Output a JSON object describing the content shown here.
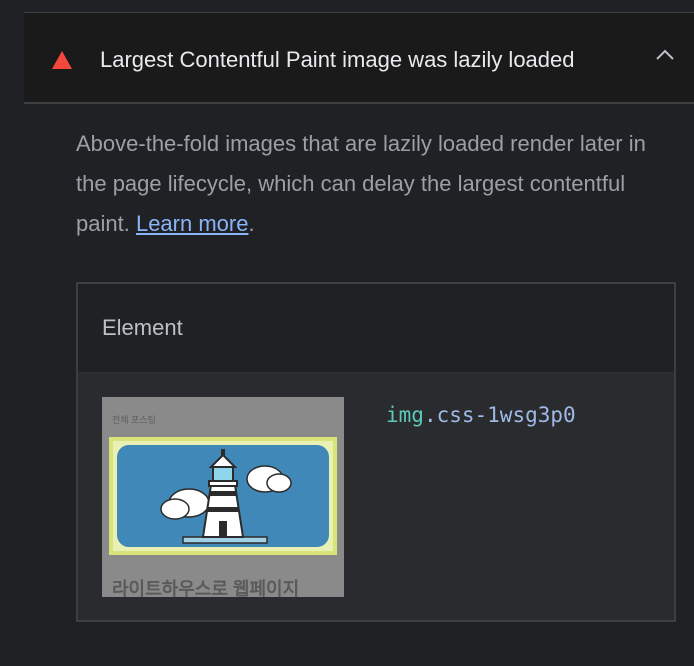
{
  "audit": {
    "title": "Largest Contentful Paint image was lazily loaded",
    "status_icon": "fail-triangle-icon",
    "status_color": "#f4483c",
    "expanded": true
  },
  "description": {
    "text": "Above-the-fold images that are lazily loaded render later in the page lifecycle, which can delay the largest contentful paint.",
    "link_label": "Learn more",
    "trailing": "."
  },
  "table": {
    "headers": [
      "Element"
    ],
    "rows": [
      {
        "thumbnail": {
          "small_label": "전체 포스팅",
          "caption": "라이트하우스로 웹페이지",
          "image": "lighthouse-illustration"
        },
        "selector_tag": "img",
        "selector_class": ".css-1wsg3p0"
      }
    ]
  },
  "colors": {
    "background": "#202124",
    "header_bg": "#1a1a1a",
    "link": "#8ab4f8",
    "highlight": "#d8e47a"
  }
}
